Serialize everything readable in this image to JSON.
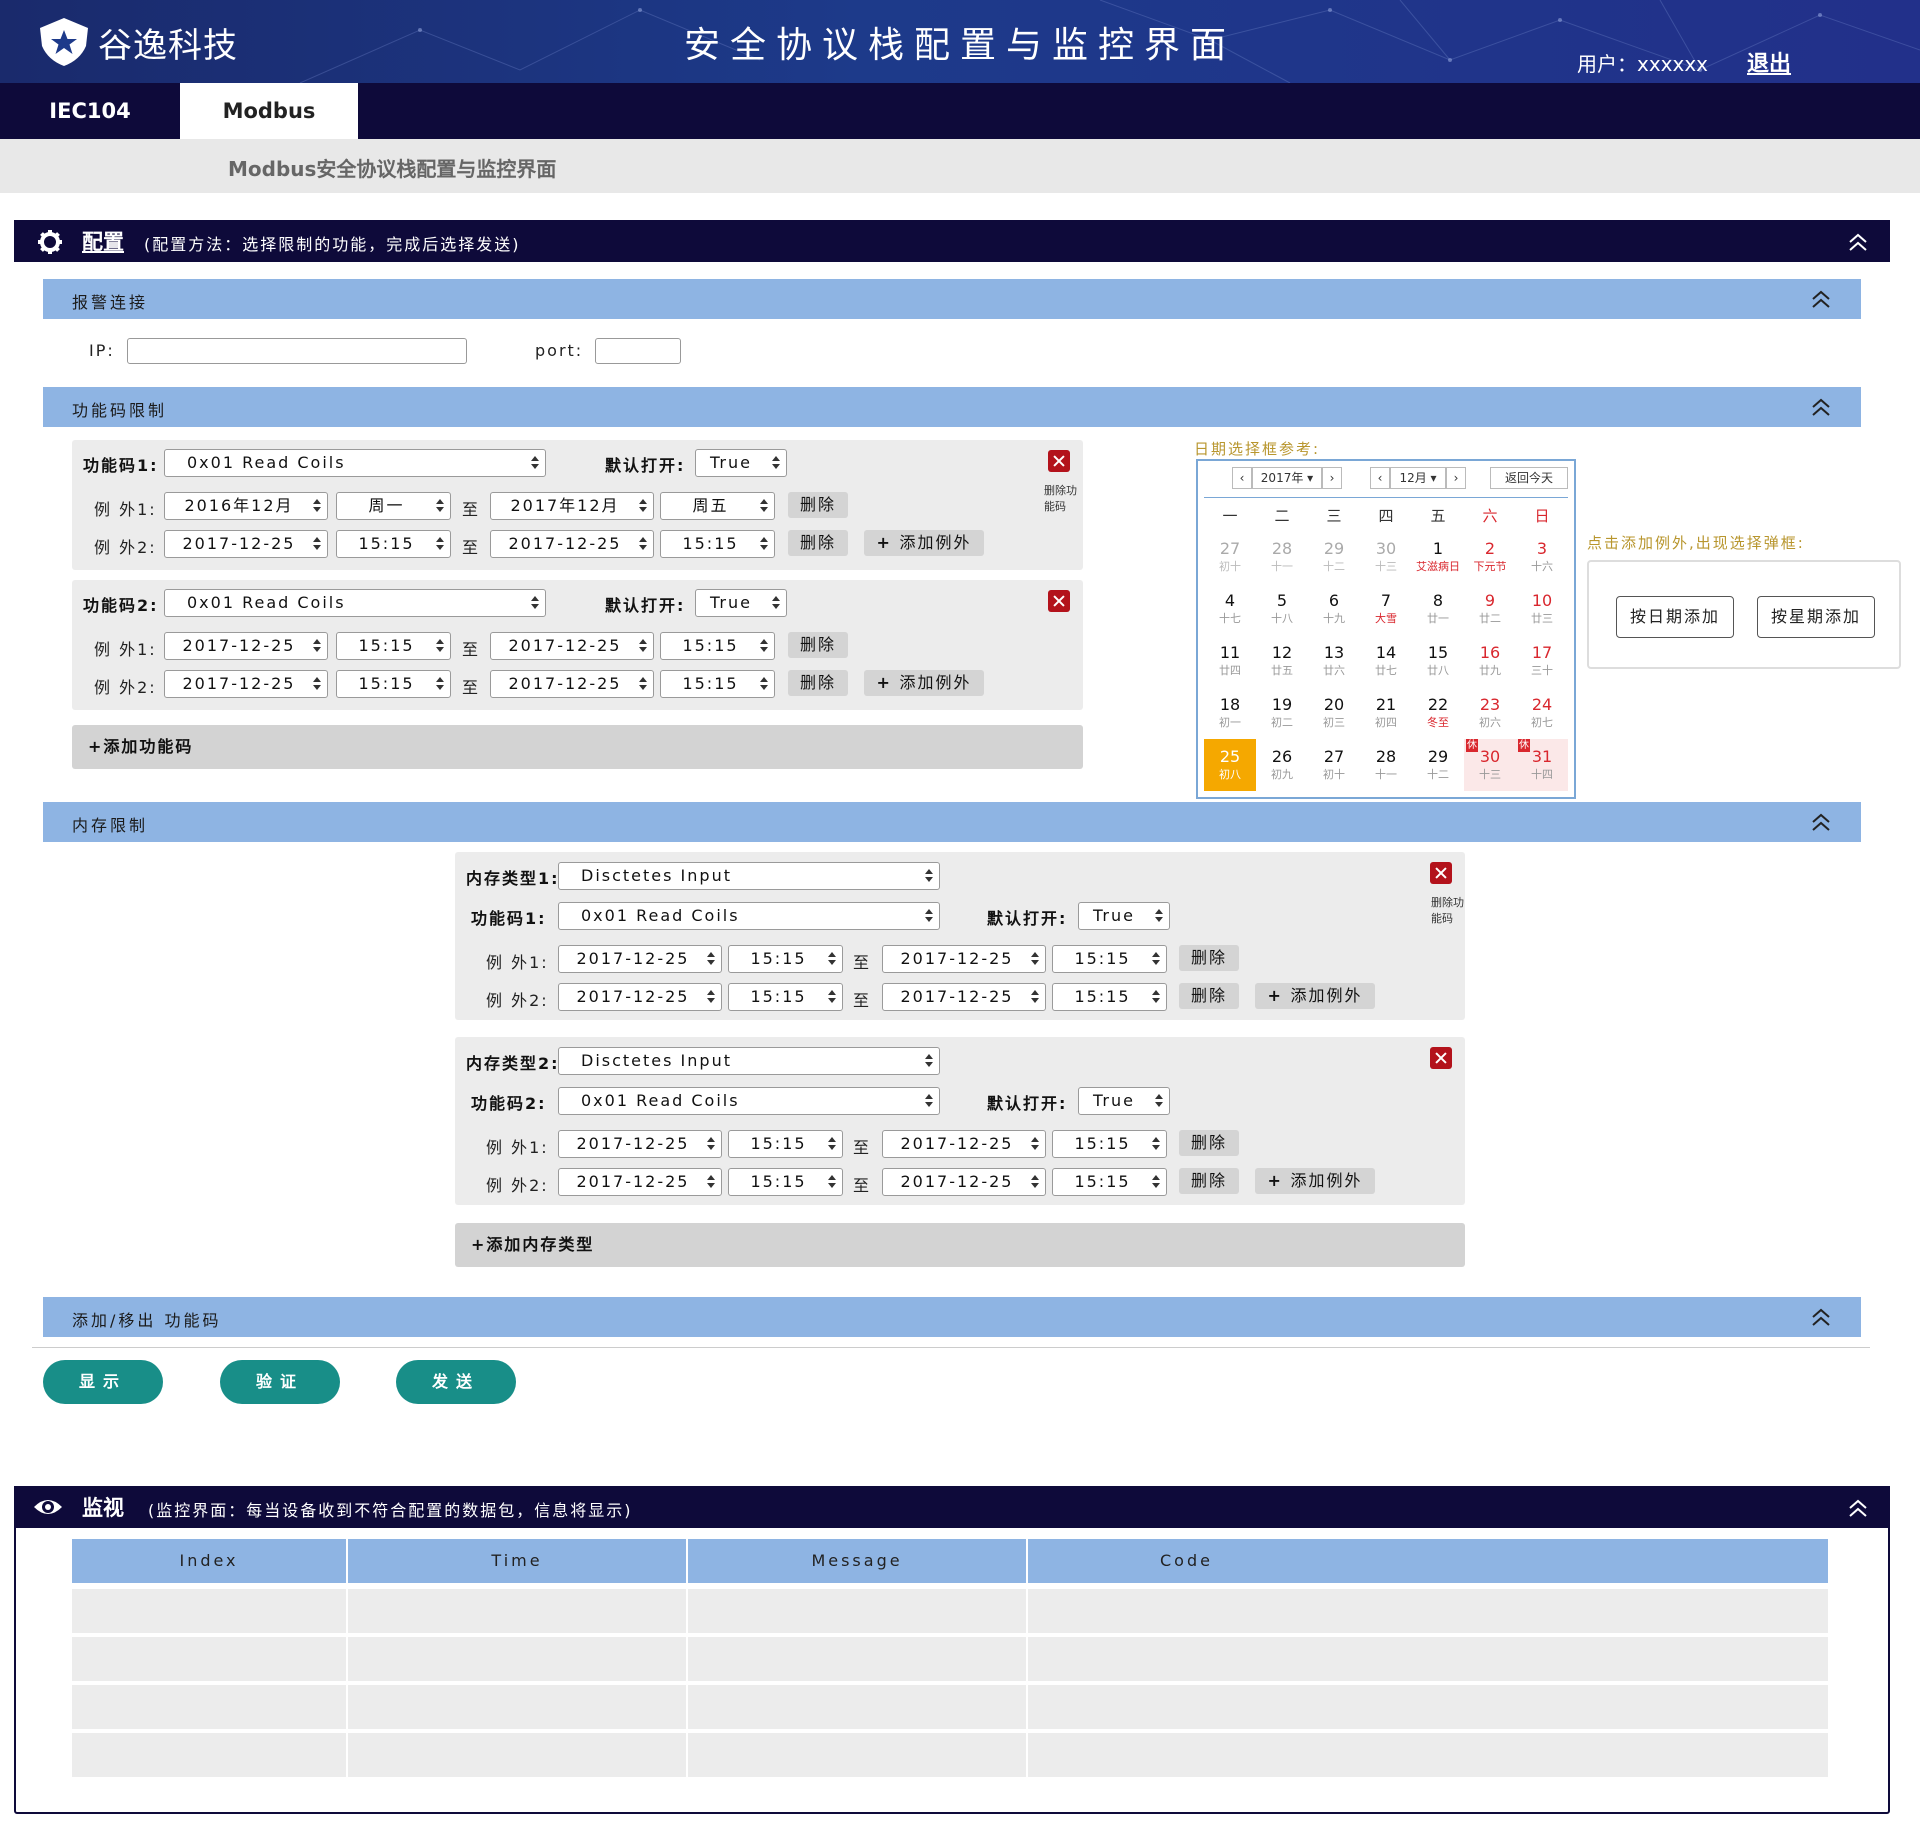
{
  "header": {
    "logo_text": "谷逸科技",
    "system_title": "安全协议栈配置与监控界面",
    "user_label": "用户：xxxxxx",
    "logout": "退出"
  },
  "tabs": [
    {
      "label": "IEC104"
    },
    {
      "label": "Modbus"
    }
  ],
  "subtitle": "Modbus安全协议栈配置与监控界面",
  "config": {
    "title": "配置",
    "hint": "(配置方法：选择限制的功能，完成后选择发送)",
    "alarm": {
      "title": "报警连接",
      "ip_label": "IP:",
      "port_label": "port:"
    },
    "fc_section": {
      "title": "功能码限制",
      "items": [
        {
          "label": "功能码1:",
          "value": "0x01 Read Coils",
          "default_label": "默认打开:",
          "default_value": "True",
          "ex1": {
            "label": "例 外1:",
            "a": "2016年12月",
            "b": "周一",
            "to": "至",
            "c": "2017年12月",
            "d": "周五"
          },
          "ex2": {
            "label": "例 外2:",
            "a": "2017-12-25",
            "b": "15:15",
            "to": "至",
            "c": "2017-12-25",
            "d": "15:15"
          },
          "delete": "删除",
          "add_exception": "添加例外",
          "delete_fc": "删除功能码"
        },
        {
          "label": "功能码2:",
          "value": "0x01 Read Coils",
          "default_label": "默认打开:",
          "default_value": "True",
          "ex1": {
            "label": "例 外1:",
            "a": "2017-12-25",
            "b": "15:15",
            "to": "至",
            "c": "2017-12-25",
            "d": "15:15"
          },
          "ex2": {
            "label": "例 外2:",
            "a": "2017-12-25",
            "b": "15:15",
            "to": "至",
            "c": "2017-12-25",
            "d": "15:15"
          },
          "delete": "删除",
          "add_exception": "添加例外"
        }
      ],
      "add_fc": "+添加功能码"
    },
    "calendar": {
      "caption": "日期选择框参考:",
      "year": "2017年",
      "month": "12月",
      "today": "返回今天",
      "weekdays": [
        "一",
        "二",
        "三",
        "四",
        "五",
        "六",
        "日"
      ],
      "rows": [
        [
          [
            "27",
            "初十"
          ],
          [
            "28",
            "十一"
          ],
          [
            "29",
            "十二"
          ],
          [
            "30",
            "十三"
          ],
          [
            "1",
            "艾滋病日"
          ],
          [
            "2",
            "下元节"
          ],
          [
            "3",
            "十六"
          ]
        ],
        [
          [
            "4",
            "十七"
          ],
          [
            "5",
            "十八"
          ],
          [
            "6",
            "十九"
          ],
          [
            "7",
            "大雪"
          ],
          [
            "8",
            "廿一"
          ],
          [
            "9",
            "廿二"
          ],
          [
            "10",
            "廿三"
          ]
        ],
        [
          [
            "11",
            "廿四"
          ],
          [
            "12",
            "廿五"
          ],
          [
            "13",
            "廿六"
          ],
          [
            "14",
            "廿七"
          ],
          [
            "15",
            "廿八"
          ],
          [
            "16",
            "廿九"
          ],
          [
            "17",
            "三十"
          ]
        ],
        [
          [
            "18",
            "初一"
          ],
          [
            "19",
            "初二"
          ],
          [
            "20",
            "初三"
          ],
          [
            "21",
            "初四"
          ],
          [
            "22",
            "冬至"
          ],
          [
            "23",
            "初六"
          ],
          [
            "24",
            "初七"
          ]
        ],
        [
          [
            "25",
            "初八"
          ],
          [
            "26",
            "初九"
          ],
          [
            "27",
            "初十"
          ],
          [
            "28",
            "十一"
          ],
          [
            "29",
            "十二"
          ],
          [
            "30",
            "十三"
          ],
          [
            "31",
            "十四"
          ]
        ]
      ],
      "holiday_badge": "休"
    },
    "popup": {
      "caption": "点击添加例外,出现选择弹框:",
      "by_date": "按日期添加",
      "by_week": "按星期添加"
    },
    "mem_section": {
      "title": "内存限制",
      "items": [
        {
          "type_label": "内存类型1:",
          "type_value": "Disctetes Input",
          "fc_label": "功能码1:",
          "fc_value": "0x01 Read Coils",
          "default_label": "默认打开:",
          "default_value": "True",
          "ex1": {
            "label": "例 外1:",
            "a": "2017-12-25",
            "b": "15:15",
            "to": "至",
            "c": "2017-12-25",
            "d": "15:15"
          },
          "ex2": {
            "label": "例 外2:",
            "a": "2017-12-25",
            "b": "15:15",
            "to": "至",
            "c": "2017-12-25",
            "d": "15:15"
          },
          "delete": "删除",
          "add_exception": "添加例外",
          "delete_fc": "删除功能码"
        },
        {
          "type_label": "内存类型2:",
          "type_value": "Disctetes Input",
          "fc_label": "功能码2:",
          "fc_value": "0x01 Read Coils",
          "default_label": "默认打开:",
          "default_value": "True",
          "ex1": {
            "label": "例 外1:",
            "a": "2017-12-25",
            "b": "15:15",
            "to": "至",
            "c": "2017-12-25",
            "d": "15:15"
          },
          "ex2": {
            "label": "例 外2:",
            "a": "2017-12-25",
            "b": "15:15",
            "to": "至",
            "c": "2017-12-25",
            "d": "15:15"
          },
          "delete": "删除",
          "add_exception": "添加例外"
        }
      ],
      "add_mem": "+添加内存类型"
    },
    "addremove": {
      "title": "添加/移出 功能码"
    },
    "actions": {
      "show": "显示",
      "verify": "验证",
      "send": "发送"
    }
  },
  "monitor": {
    "title": "监视",
    "hint": "(监控界面：每当设备收到不符合配置的数据包，信息将显示)",
    "columns": [
      "Index",
      "Time",
      "Message",
      "Code"
    ],
    "rows": [
      [
        "",
        "",
        "",
        ""
      ],
      [
        "",
        "",
        "",
        ""
      ],
      [
        "",
        "",
        "",
        ""
      ],
      [
        "",
        "",
        "",
        ""
      ]
    ]
  },
  "colors": {
    "nav": "#0e0a3a",
    "section": "#8eb4e3",
    "teal": "#188e88",
    "today": "#f5a800",
    "weekend": "#d9272e"
  }
}
